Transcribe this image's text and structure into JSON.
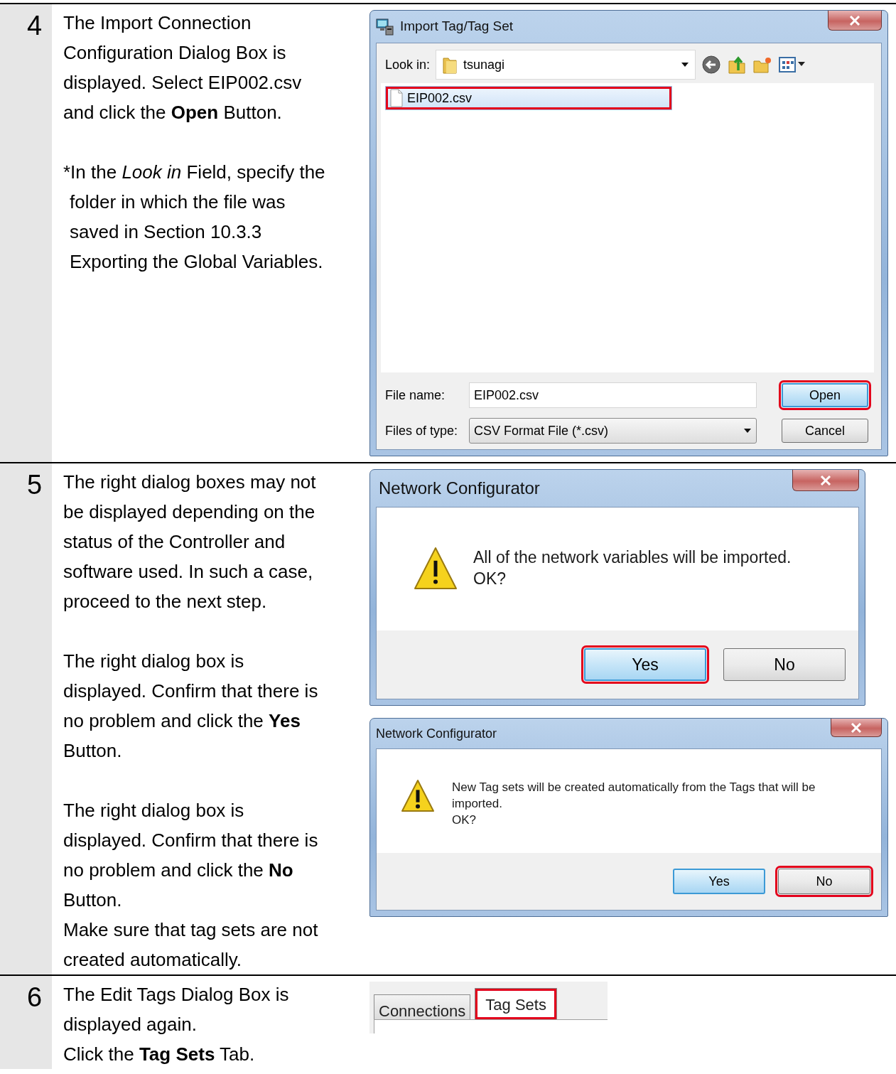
{
  "steps": [
    {
      "number": "4",
      "blocks": [
        {
          "kind": "text",
          "lines": [
            "The Import Connection\nConfiguration Dialog Box is\ndisplayed. Select EIP002.csv\nand click the **Open** Button."
          ]
        },
        {
          "kind": "note",
          "mark": "*",
          "lines": [
            "In the *Look in* Field, specify the\nfolder in which the file was\nsaved in Section 10.3.3\nExporting the Global Variables."
          ]
        }
      ],
      "screens": [
        {
          "kind": "file_dialog",
          "title": "Import Tag/Tag Set",
          "look_in_label": "Look in:",
          "look_in_value": "tsunagi",
          "files": [
            {
              "name": "EIP002.csv",
              "selected": true,
              "highlighted": true
            }
          ],
          "file_name_label": "File name:",
          "file_name_value": "EIP002.csv",
          "file_type_label": "Files of type:",
          "file_type_value": "CSV Format File (*.csv)",
          "buttons": [
            {
              "label": "Open",
              "default": true,
              "highlighted": true
            },
            {
              "label": "Cancel",
              "default": false,
              "highlighted": false
            }
          ]
        }
      ]
    },
    {
      "number": "5",
      "blocks": [
        {
          "kind": "text",
          "lines": [
            "The right dialog boxes may not\nbe displayed depending on the\nstatus of the Controller and\nsoftware used. In such a case,\nproceed to the next step."
          ]
        },
        {
          "kind": "text",
          "lines": [
            "The right dialog box is\ndisplayed. Confirm that there is\nno problem and click the **Yes**\nButton."
          ]
        },
        {
          "kind": "text",
          "lines": [
            "The right dialog box is\ndisplayed. Confirm that there is\nno problem and click the **No**\nButton.",
            "Make sure that tag sets are not\ncreated automatically."
          ]
        }
      ],
      "screens": [
        {
          "kind": "message_box",
          "title": "Network Configurator",
          "message": "All of the network variables will be imported.\nOK?",
          "buttons": [
            {
              "label": "Yes",
              "default": true,
              "highlighted": true
            },
            {
              "label": "No",
              "default": false,
              "highlighted": false
            }
          ]
        },
        {
          "kind": "message_box",
          "title": "Network Configurator",
          "message": "New Tag sets will be created automatically from the Tags that will be\nimported.\nOK?",
          "buttons": [
            {
              "label": "Yes",
              "default": true,
              "highlighted": false
            },
            {
              "label": "No",
              "default": false,
              "highlighted": true
            }
          ]
        }
      ]
    },
    {
      "number": "6",
      "blocks": [
        {
          "kind": "text",
          "lines": [
            "The Edit Tags Dialog Box is\ndisplayed again.",
            "Click the **Tag Sets** Tab."
          ]
        }
      ],
      "screens": [
        {
          "kind": "tab_strip",
          "tabs": [
            {
              "label": "Connections",
              "selected": false,
              "highlighted": false
            },
            {
              "label": "Tag Sets",
              "selected": true,
              "highlighted": true
            }
          ]
        }
      ]
    }
  ]
}
